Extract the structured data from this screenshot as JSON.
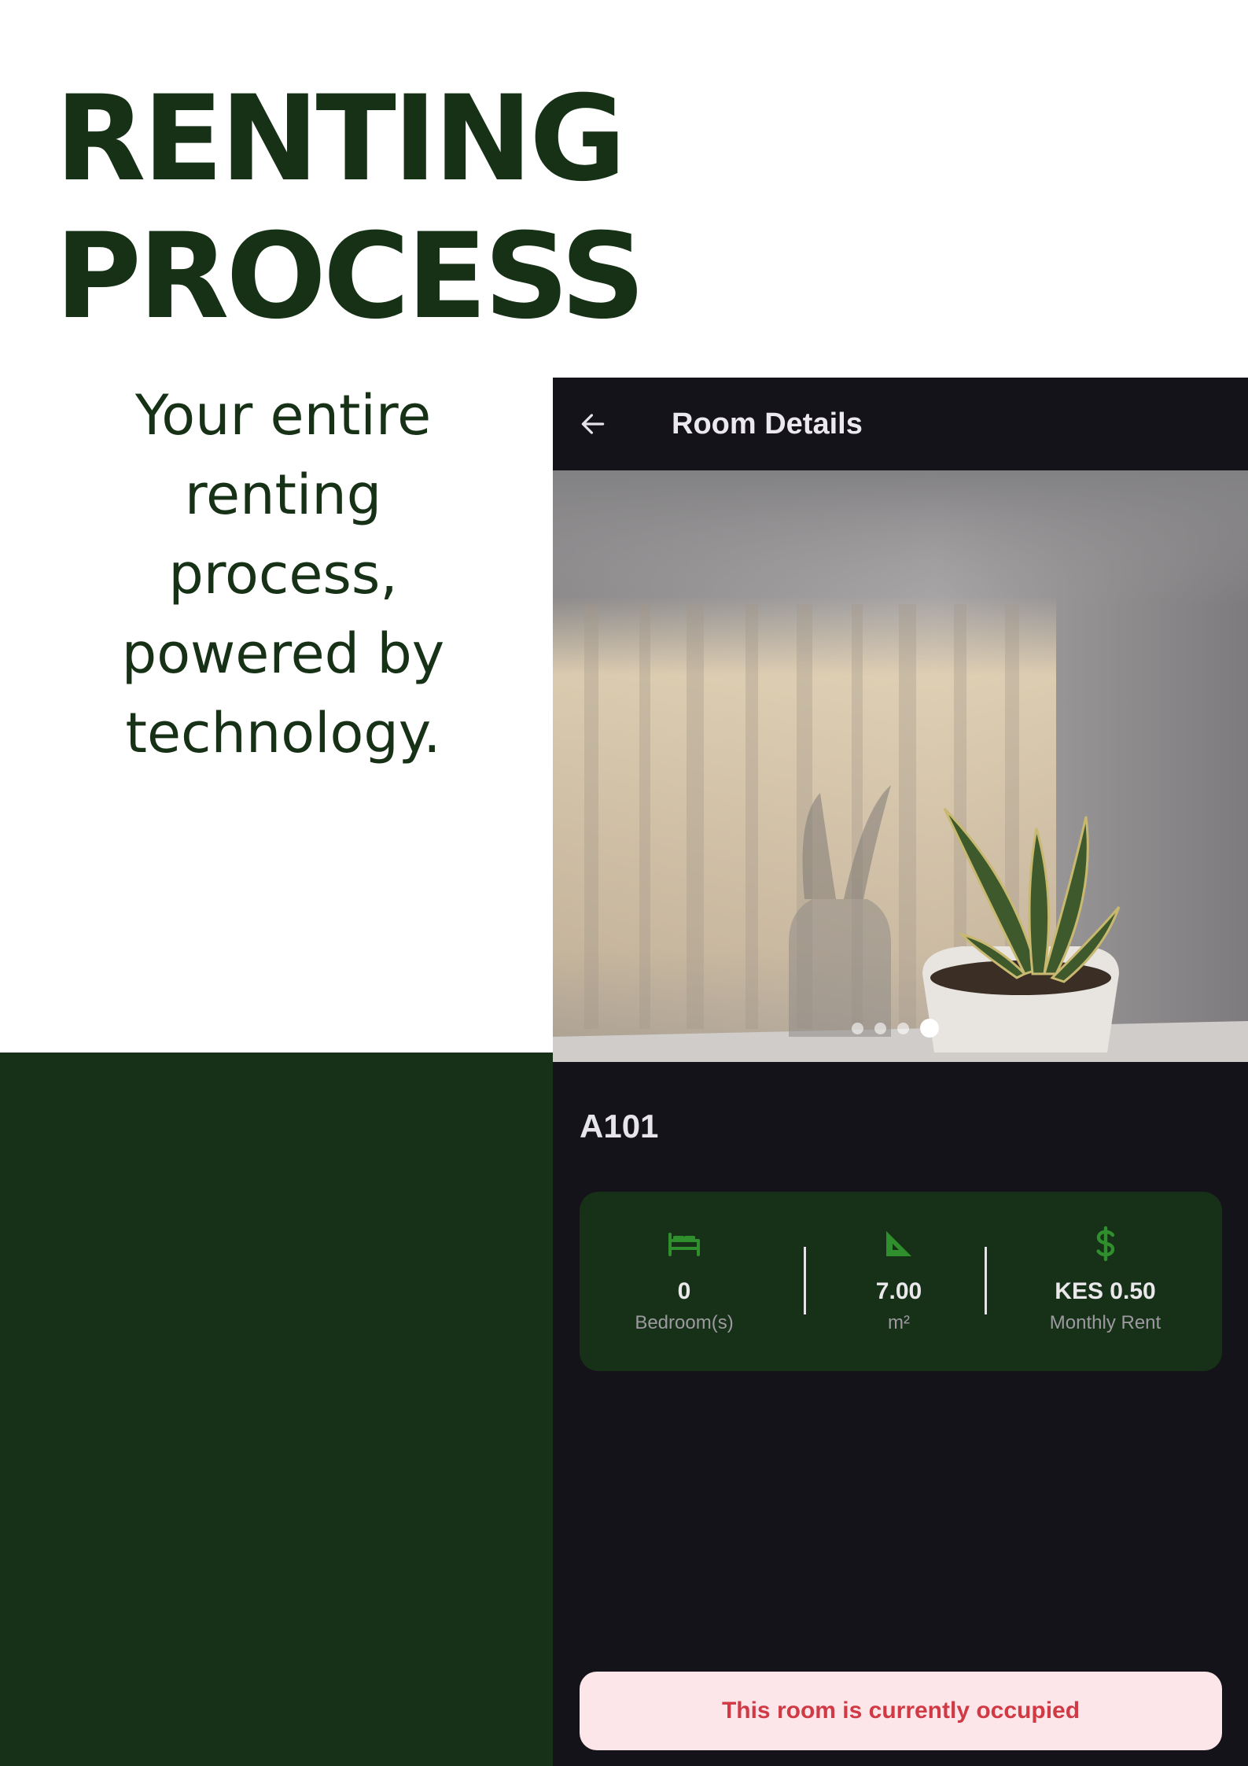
{
  "headline": {
    "line1": "RENTING",
    "line2": "PROCESS"
  },
  "tagline": "Your entire\nrenting\nprocess,\npowered by\ntechnology.",
  "app": {
    "title": "Room Details",
    "back_icon": "arrow-left-icon",
    "gallery": {
      "image_count": 4,
      "active_index": 3
    },
    "room_name": "A101",
    "stats": [
      {
        "icon": "bed-icon",
        "value": "0",
        "label": "Bedroom(s)"
      },
      {
        "icon": "ruler-triangle-icon",
        "value": "7.00",
        "label": "m²"
      },
      {
        "icon": "dollar-icon",
        "value": "KES 0.50",
        "label": "Monthly Rent"
      }
    ],
    "status_message": "This room is currently occupied"
  },
  "colors": {
    "brand_green": "#163117",
    "app_background": "#15131a",
    "card_green": "#173118",
    "icon_green": "#2f8f2c",
    "banner_background": "#fde6ea",
    "banner_text": "#d03a44"
  }
}
